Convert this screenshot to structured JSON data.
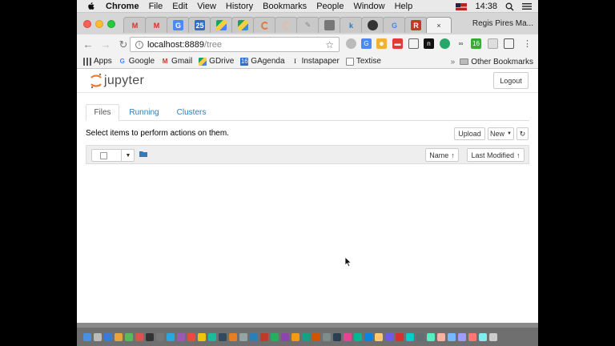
{
  "menubar": {
    "items": [
      "Chrome",
      "File",
      "Edit",
      "View",
      "History",
      "Bookmarks",
      "People",
      "Window",
      "Help"
    ],
    "time": "14:38"
  },
  "tabstrip": {
    "user_name": "Regis Pires Ma...",
    "active_tab_close": "×"
  },
  "address": {
    "host": "localhost:8889",
    "path": "/tree"
  },
  "bookmarks": {
    "items": [
      "Apps",
      "Google",
      "Gmail",
      "GDrive",
      "GAgenda",
      "Instapaper",
      "Textise"
    ],
    "other": "Other Bookmarks"
  },
  "jupyter": {
    "logo_text": "jupyter",
    "logout_label": "Logout",
    "tabs": [
      "Files",
      "Running",
      "Clusters"
    ],
    "hint": "Select items to perform actions on them.",
    "upload_label": "Upload",
    "new_label": "New",
    "sort_name_label": "Name",
    "sort_modified_label": "Last Modified"
  },
  "colors": {
    "jupyter_orange": "#f37726",
    "link_blue": "#337ab7",
    "folder_blue": "#337ab7"
  }
}
